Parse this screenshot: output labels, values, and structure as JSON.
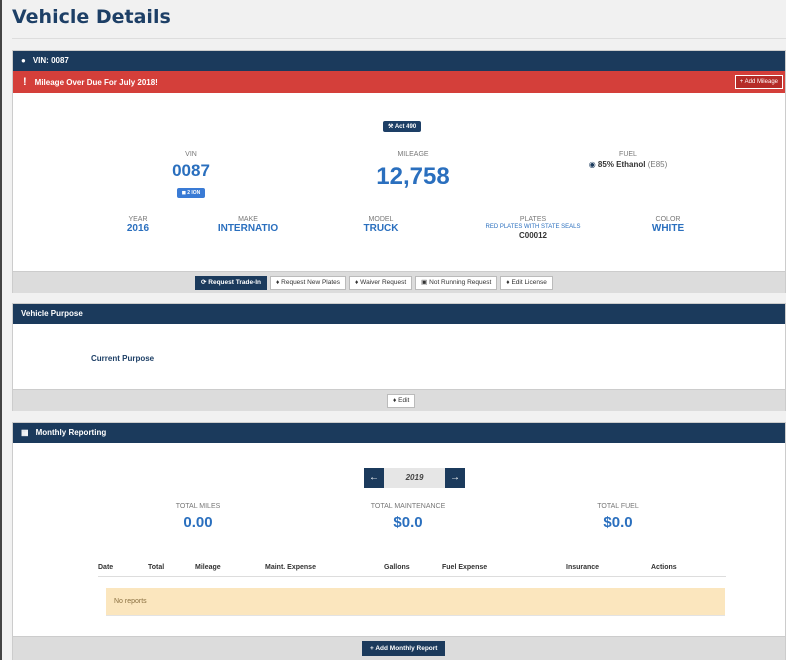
{
  "page": {
    "title": "Vehicle Details"
  },
  "vin_header": {
    "label": "VIN: 0087"
  },
  "alert": {
    "message": "Mileage Over Due For July 2018!",
    "add_mileage": "+ Add Mileage"
  },
  "details": {
    "act_badge": "Act 490",
    "vin": {
      "label": "VIN",
      "value": "0087",
      "badge": "2 ION"
    },
    "mileage": {
      "label": "MILEAGE",
      "value": "12,758"
    },
    "fuel": {
      "label": "FUEL",
      "value": "85% Ethanol",
      "suffix": "(E85)"
    },
    "year": {
      "label": "YEAR",
      "value": "2016"
    },
    "make": {
      "label": "MAKE",
      "value": "INTERNATIO"
    },
    "model": {
      "label": "MODEL",
      "value": "TRUCK"
    },
    "plates": {
      "label": "PLATES",
      "type": "RED PLATES WITH STATE SEALS",
      "value": "C00012"
    },
    "color": {
      "label": "COLOR",
      "value": "WHITE"
    }
  },
  "actions": {
    "request_trade_in": "Request Trade-In",
    "request_new_plates": "Request New Plates",
    "waiver_request": "Waiver Request",
    "not_running_request": "Not Running Request",
    "edit_license": "Edit License"
  },
  "purpose": {
    "header": "Vehicle Purpose",
    "current_label": "Current Purpose",
    "edit": "Edit"
  },
  "monthly": {
    "header": "Monthly Reporting",
    "year": "2019",
    "total_miles": {
      "label": "TOTAL MILES",
      "value": "0.00"
    },
    "total_maintenance": {
      "label": "TOTAL MAINTENANCE",
      "value": "$0.0"
    },
    "total_fuel": {
      "label": "TOTAL FUEL",
      "value": "$0.0"
    },
    "columns": [
      "Date",
      "Total",
      "Mileage",
      "Maint. Expense",
      "Gallons",
      "Fuel Expense",
      "Insurance",
      "Actions"
    ],
    "empty_text": "No reports",
    "add_report": "+ Add Monthly Report"
  }
}
